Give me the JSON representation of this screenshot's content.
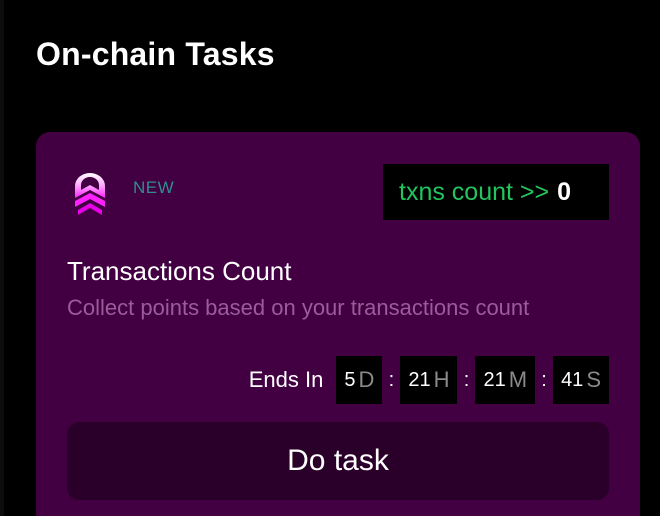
{
  "page": {
    "title": "On-chain Tasks"
  },
  "task": {
    "icon": "chevron-logo-icon",
    "badge": "NEW",
    "txns_label": "txns count >>",
    "txns_value": "0",
    "title": "Transactions Count",
    "description": "Collect points based on your transactions count",
    "ends_in_label": "Ends In",
    "countdown": {
      "days": "5",
      "days_unit": "D",
      "hours": "21",
      "hours_unit": "H",
      "minutes": "21",
      "minutes_unit": "M",
      "seconds": "41",
      "seconds_unit": "S",
      "separator": ":"
    },
    "button_label": "Do task"
  },
  "colors": {
    "background": "#000000",
    "card": "#420042",
    "button": "#2a002a",
    "accent_green": "#22c55e",
    "badge_teal": "#2f8e8e",
    "logo_pink": "#ff33ff"
  }
}
